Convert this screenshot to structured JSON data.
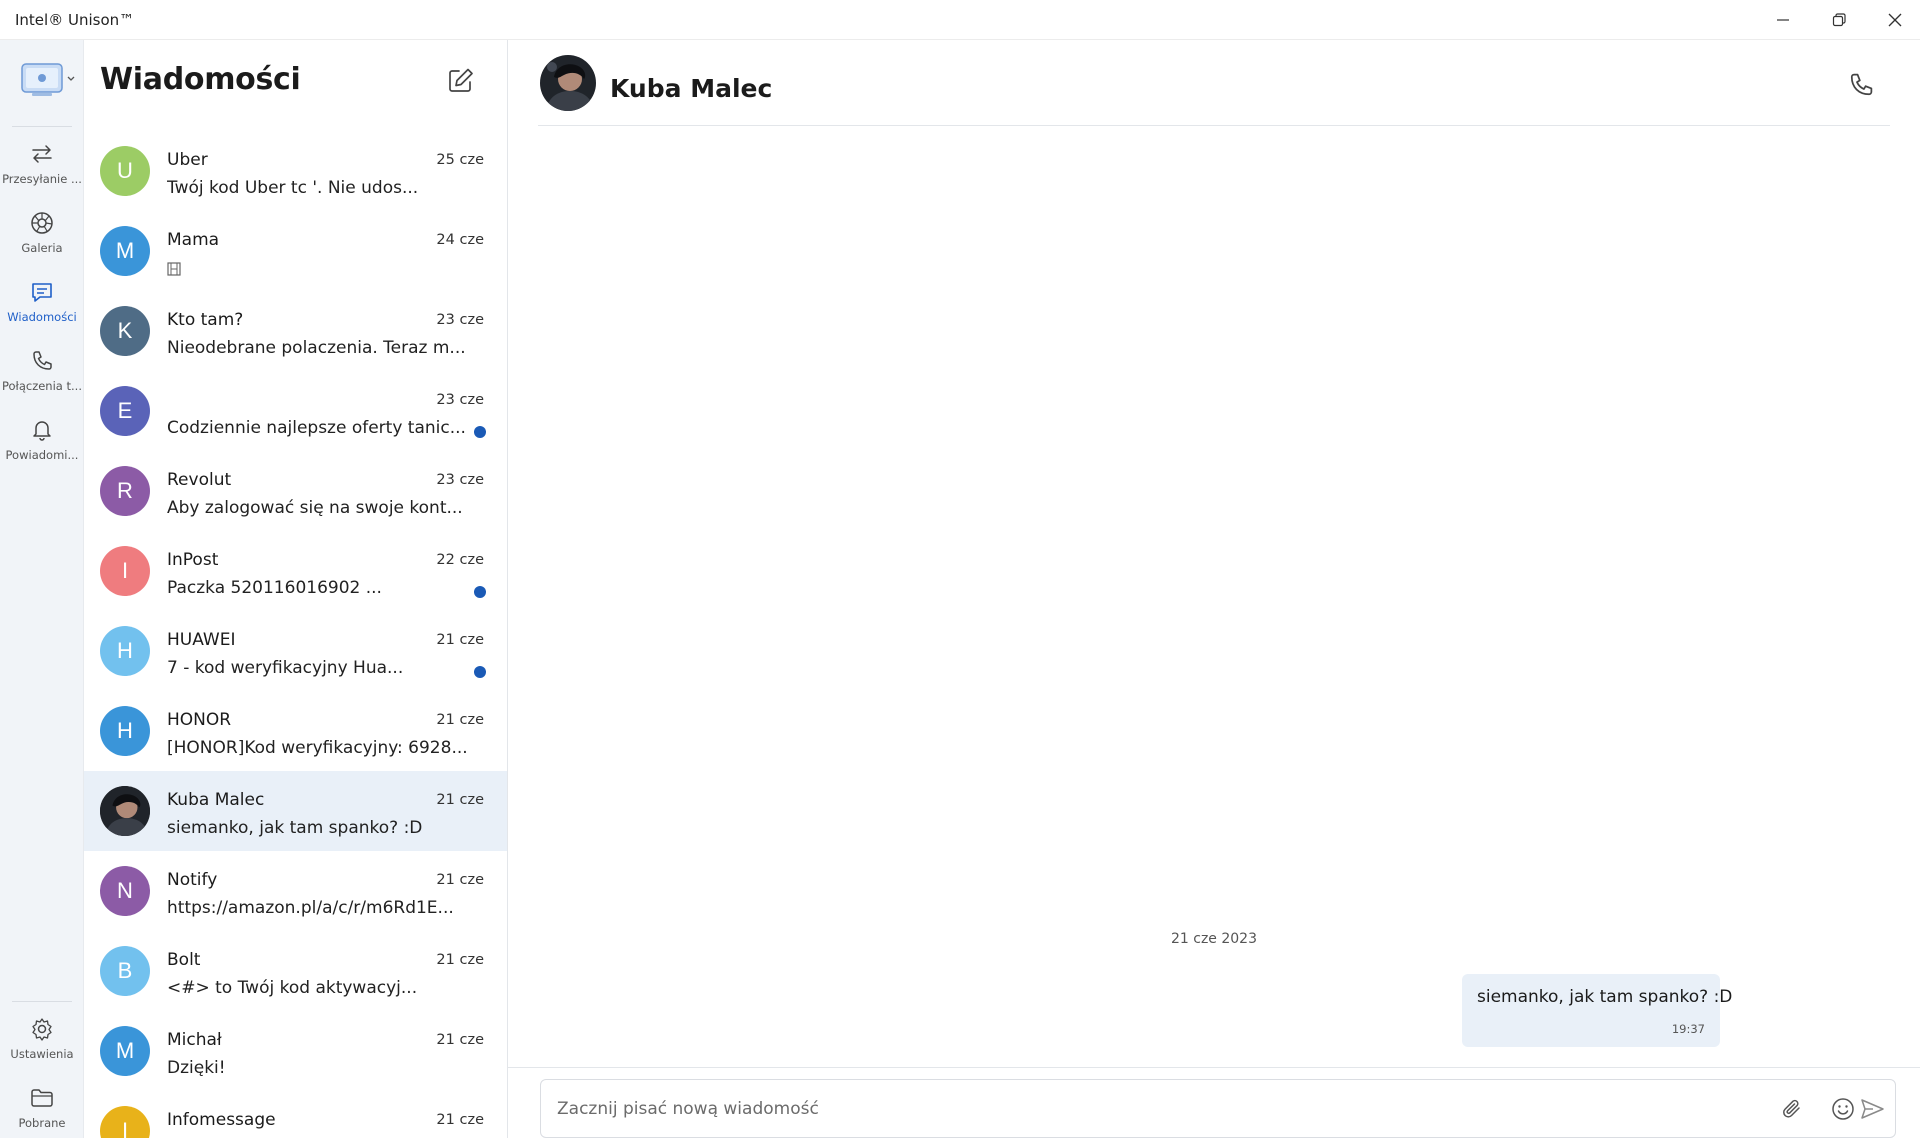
{
  "window": {
    "title": "Intel® Unison™"
  },
  "nav": {
    "items": [
      {
        "label": "Przesyłanie ...",
        "icon": "transfer-icon"
      },
      {
        "label": "Galeria",
        "icon": "gallery-icon"
      },
      {
        "label": "Wiadomości",
        "icon": "messages-icon",
        "active": true
      },
      {
        "label": "Połączenia t...",
        "icon": "phone-icon"
      },
      {
        "label": "Powiadomi...",
        "icon": "bell-icon"
      }
    ],
    "bottom": [
      {
        "label": "Ustawienia",
        "icon": "gear-icon"
      },
      {
        "label": "Pobrane",
        "icon": "folder-icon"
      }
    ]
  },
  "conversations": {
    "title": "Wiadomości",
    "items": [
      {
        "initial": "U",
        "color": "#9ccc65",
        "name": "Uber",
        "date": "25 cze",
        "preview": "Twój kod Uber tc        '. Nie udos...",
        "unread": false
      },
      {
        "initial": "M",
        "color": "#3a95d9",
        "name": "Mama",
        "date": "24 cze",
        "preview": "",
        "unread": false,
        "attachment": true
      },
      {
        "initial": "K",
        "color": "#4f6c86",
        "name": "Kto tam?",
        "date": "23 cze",
        "preview": "Nieodebrane polaczenia. Teraz m...",
        "unread": false
      },
      {
        "initial": "E",
        "color": "#5a63b8",
        "name": "",
        "date": "23 cze",
        "preview": "Codziennie najlepsze oferty tanic...",
        "unread": true
      },
      {
        "initial": "R",
        "color": "#8c5ba6",
        "name": "Revolut",
        "date": "23 cze",
        "preview": "Aby zalogować się na swoje kont...",
        "unread": false
      },
      {
        "initial": "I",
        "color": "#ef7c7f",
        "name": "InPost",
        "date": "22 cze",
        "preview": "Paczka 520116016902          ...",
        "unread": true
      },
      {
        "initial": "H",
        "color": "#72c1ee",
        "name": "HUAWEI",
        "date": "21 cze",
        "preview": "        7 - kod weryfikacyjny Hua...",
        "unread": true
      },
      {
        "initial": "H",
        "color": "#3a95d9",
        "name": "HONOR",
        "date": "21 cze",
        "preview": "[HONOR]Kod weryfikacyjny: 6928...",
        "unread": false
      },
      {
        "initial": "",
        "color": "#222222",
        "name": "Kuba Malec",
        "date": "21 cze",
        "preview": "siemanko, jak tam spanko? :D",
        "unread": false,
        "selected": true,
        "photo": true
      },
      {
        "initial": "N",
        "color": "#8c5ba6",
        "name": "Notify",
        "date": "21 cze",
        "preview": "https://amazon.pl/a/c/r/m6Rd1E...",
        "unread": false
      },
      {
        "initial": "B",
        "color": "#72c1ee",
        "name": "Bolt",
        "date": "21 cze",
        "preview": "<#>          to Twój kod aktywacyj...",
        "unread": false
      },
      {
        "initial": "M",
        "color": "#3a95d9",
        "name": "Michał",
        "date": "21 cze",
        "preview": "Dzięki!",
        "unread": false
      },
      {
        "initial": "I",
        "color": "#e8b21a",
        "name": "Infomessage",
        "date": "21 cze",
        "preview": "",
        "unread": false
      }
    ]
  },
  "chat": {
    "contact_name": "Kuba Malec",
    "date_separator": "21 cze 2023",
    "message_text": "siemanko, jak tam spanko? :D",
    "message_time": "19:37",
    "composer_placeholder": "Zacznij pisać nową wiadomość"
  },
  "colors": {
    "accent": "#1f5fc8",
    "rail_bg": "#f1f4f8",
    "selected_bg": "#e9f0f8",
    "unread_dot": "#1a5ab6"
  }
}
